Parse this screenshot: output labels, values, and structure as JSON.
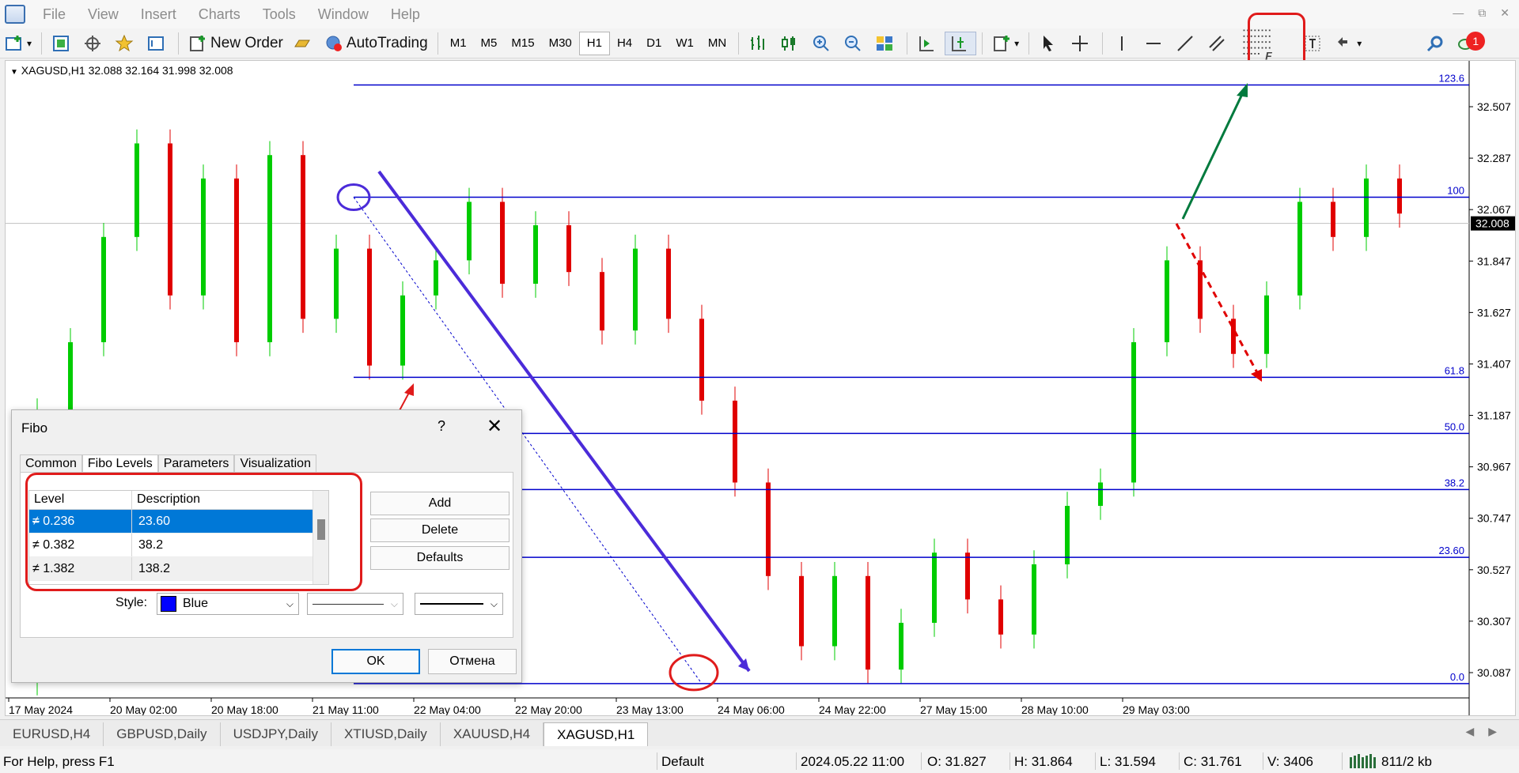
{
  "menu": [
    "File",
    "View",
    "Insert",
    "Charts",
    "Tools",
    "Window",
    "Help"
  ],
  "toolbar": {
    "new_order": "New Order",
    "auto_trading": "AutoTrading",
    "timeframes": [
      "M1",
      "M5",
      "M15",
      "M30",
      "H1",
      "H4",
      "D1",
      "W1",
      "MN"
    ],
    "selected_timeframe": "H1",
    "notification_count": "1"
  },
  "chart": {
    "symbol_info": "XAGUSD,H1  32.088 32.164 31.998 32.008",
    "current_price": "32.008",
    "price_labels": [
      "32.507",
      "32.287",
      "32.067",
      "31.847",
      "31.627",
      "31.407",
      "31.187",
      "30.967",
      "30.747",
      "30.527",
      "30.307",
      "30.087"
    ],
    "time_labels": [
      "17 May 2024",
      "20 May 02:00",
      "20 May 18:00",
      "21 May 11:00",
      "22 May 04:00",
      "22 May 20:00",
      "23 May 13:00",
      "24 May 06:00",
      "24 May 22:00",
      "27 May 15:00",
      "28 May 10:00",
      "29 May 03:00"
    ],
    "fibo_levels": [
      {
        "label": "123.6",
        "price": 32.6
      },
      {
        "label": "100",
        "price": 32.12
      },
      {
        "label": "61.8",
        "price": 31.35
      },
      {
        "label": "50.0",
        "price": 31.11
      },
      {
        "label": "38.2",
        "price": 30.87
      },
      {
        "label": "23.60",
        "price": 30.58
      },
      {
        "label": "0.0",
        "price": 30.04
      }
    ],
    "colors": {
      "bull": "#00cc00",
      "bear": "#e00000",
      "fibo": "#0000cc",
      "arrow_up": "#007a3d",
      "arrow_down": "#e00000",
      "trend": "#4b2bd9",
      "annotation": "#e01b1b"
    }
  },
  "dialog": {
    "title": "Fibo",
    "help": "?",
    "close": "✕",
    "tabs": [
      "Common",
      "Fibo Levels",
      "Parameters",
      "Visualization"
    ],
    "active_tab": "Fibo Levels",
    "table": {
      "headers": [
        "Level",
        "Description"
      ],
      "rows": [
        {
          "level": "0.236",
          "description": "23.60"
        },
        {
          "level": "0.382",
          "description": "38.2"
        },
        {
          "level": "1.382",
          "description": "138.2"
        }
      ]
    },
    "buttons": {
      "add": "Add",
      "delete": "Delete",
      "defaults": "Defaults",
      "ok": "OK",
      "cancel": "Отмена"
    },
    "style_label": "Style:",
    "color_value": "Blue"
  },
  "tabs": [
    "EURUSD,H4",
    "GBPUSD,Daily",
    "USDJPY,Daily",
    "XTIUSD,Daily",
    "XAUUSD,H4",
    "XAGUSD,H1"
  ],
  "active_tab": "XAGUSD,H1",
  "status": {
    "help": "For Help, press F1",
    "profile": "Default",
    "datetime": "2024.05.22 11:00",
    "open": "O: 31.827",
    "high": "H: 31.864",
    "low": "L: 31.594",
    "close": "C: 31.761",
    "volume": "V: 3406",
    "traffic": "811/2 kb"
  }
}
